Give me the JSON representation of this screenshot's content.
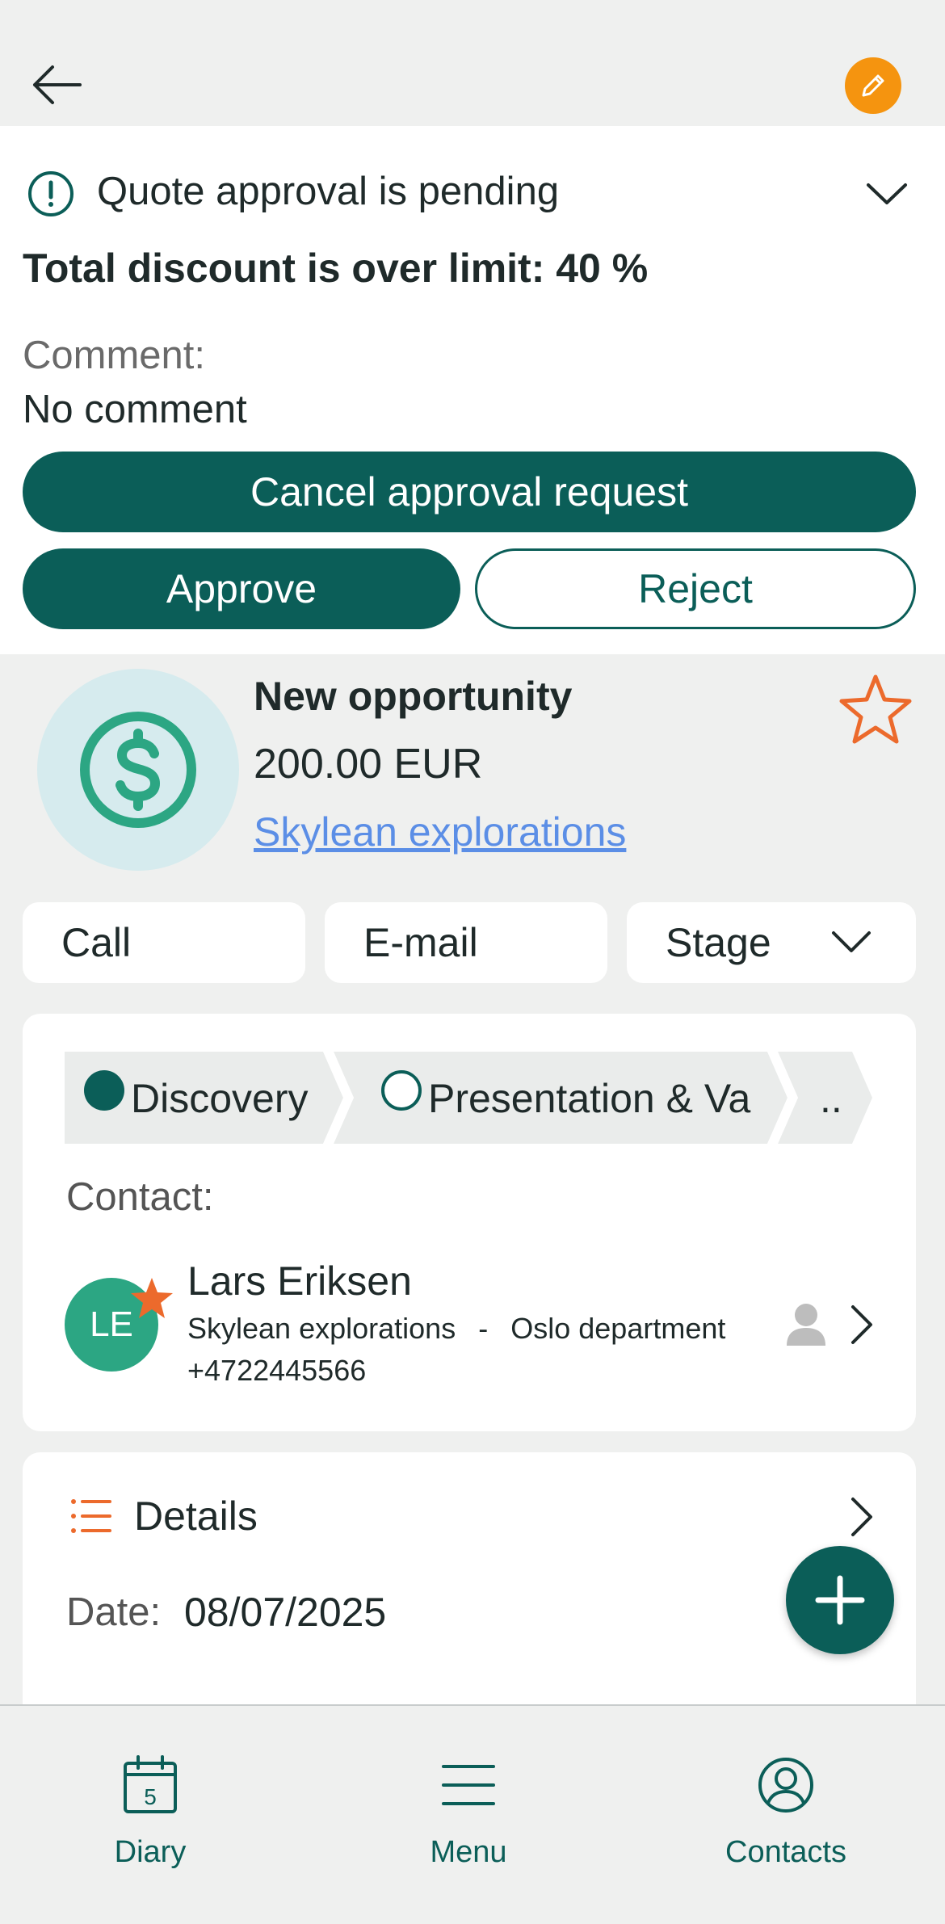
{
  "approval": {
    "status_text": "Quote approval is pending",
    "discount_text": "Total discount is over limit: 40 %",
    "comment_label": "Comment:",
    "comment_value": "No comment",
    "cancel_label": "Cancel approval request",
    "approve_label": "Approve",
    "reject_label": "Reject"
  },
  "opportunity": {
    "title": "New opportunity",
    "amount": "200.00 EUR",
    "company": "Skylean explorations",
    "icon": "dollar-icon",
    "favorite": false
  },
  "actions": {
    "call_label": "Call",
    "email_label": "E-mail",
    "stage_label": "Stage"
  },
  "stages": [
    {
      "label": "Discovery",
      "state": "current"
    },
    {
      "label": "Presentation & Va",
      "state": "pending"
    },
    {
      "label": "..",
      "state": "more"
    }
  ],
  "contact": {
    "section_label": "Contact:",
    "initials": "LE",
    "name": "Lars Eriksen",
    "company": "Skylean explorations",
    "separator": "-",
    "department": "Oslo department",
    "phone": "+4722445566"
  },
  "details": {
    "title": "Details",
    "date_label": "Date:",
    "date_value": "08/07/2025"
  },
  "nav": {
    "diary_label": "Diary",
    "diary_day": "5",
    "menu_label": "Menu",
    "contacts_label": "Contacts"
  },
  "colors": {
    "primary": "#0b5e58",
    "accent_orange": "#f5940f",
    "star_orange": "#ec6a2c",
    "link_blue": "#5b8ee6",
    "avatar_green": "#2ca683",
    "background": "#eff0ef"
  }
}
